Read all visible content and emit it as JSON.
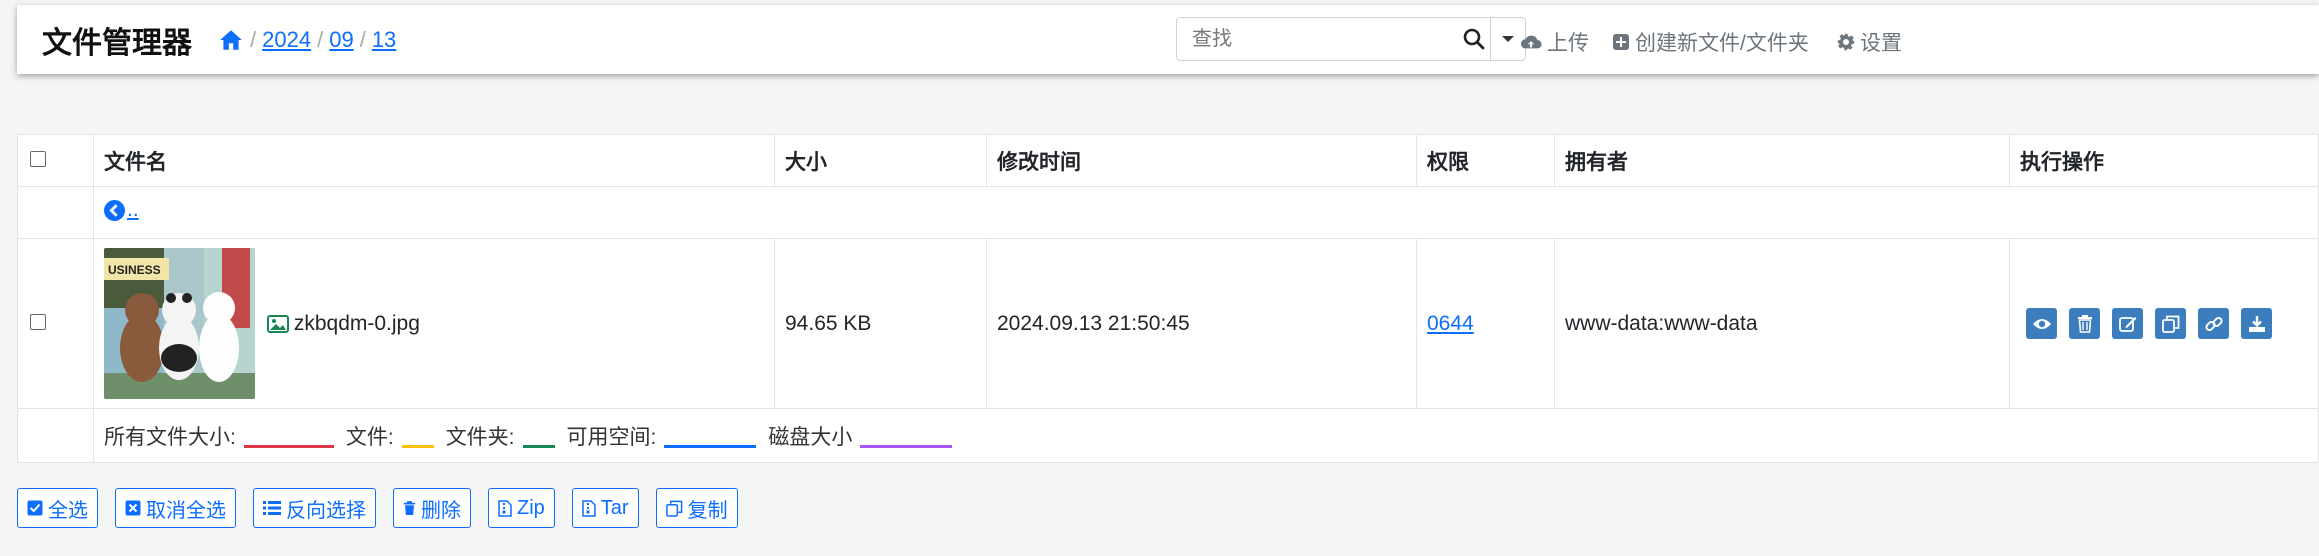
{
  "app": {
    "title": "文件管理器"
  },
  "breadcrumb": [
    "2024",
    "09",
    "13"
  ],
  "search": {
    "placeholder": "查找"
  },
  "nav": {
    "upload": "上传",
    "create": "创建新文件/文件夹",
    "settings": "设置"
  },
  "table": {
    "headers": {
      "name": "文件名",
      "size": "大小",
      "modified": "修改时间",
      "perms": "权限",
      "owner": "拥有者",
      "actions": "执行操作"
    },
    "parent_label": "..",
    "row": {
      "name": "zkbqdm-0.jpg",
      "size": "94.65 KB",
      "modified": "2024.09.13 21:50:45",
      "perms": "0644",
      "owner": "www-data:www-data",
      "thumb_text": "USINESS"
    },
    "footer": {
      "total_label": "所有文件大小:",
      "files_label": "文件:",
      "folders_label": "文件夹:",
      "free_label": "可用空间:",
      "disk_label": "磁盘大小"
    }
  },
  "buttons": {
    "select_all": "全选",
    "deselect_all": "取消全选",
    "invert": "反向选择",
    "delete": "删除",
    "zip": "Zip",
    "tar": "Tar",
    "copy": "复制"
  },
  "colors": {
    "primary": "#0d6efd",
    "action_button": "#3b7dbd",
    "total_underline": "#dc3545",
    "files_underline": "#ffc107",
    "folders_underline": "#198754",
    "free_underline": "#0d6efd",
    "disk_underline": "#a855f7"
  }
}
